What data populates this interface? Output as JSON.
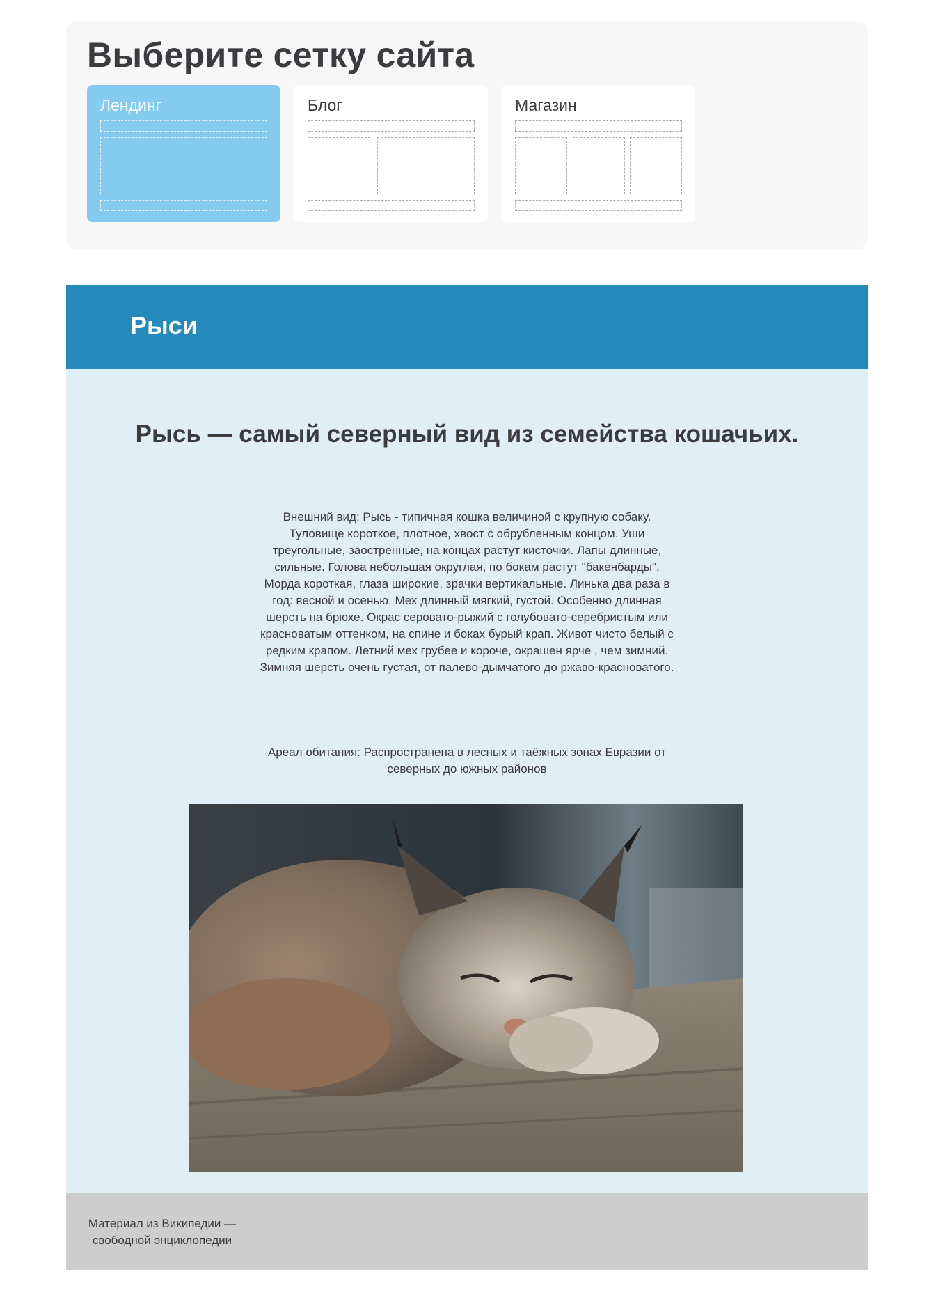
{
  "picker": {
    "title": "Выберите сетку сайта",
    "options": [
      {
        "label": "Лендинг",
        "selected": true
      },
      {
        "label": "Блог",
        "selected": false
      },
      {
        "label": "Магазин",
        "selected": false
      }
    ],
    "selected_color": "#83cbef"
  },
  "article": {
    "header_title": "Рыси",
    "headline": "Рысь — самый северный вид из семейства кошачьих.",
    "appearance": "Внешний вид: Рысь - типичная кошка величиной с крупную собаку. Туловище короткое, плотное, хвост с обрубленным концом. Уши треугольные, заостренные, на концах растут кисточки. Лапы длинные, сильные. Голова небольшая округлая, по бокам растут \"бакенбарды\". Морда короткая, глаза широкие, зрачки вертикальные. Линька два раза в год: весной и осенью. Мех длинный мягкий, густой. Особенно длинная шерсть на брюхе. Окрас серовато-рыжий с голубовато-серебристым или красноватым оттенком, на спине и боках бурый крап. Живот чисто белый с редким крапом. Летний мех грубее и короче, окрашен ярче , чем зимний. Зимняя шерсть очень густая, от палево-дымчатого до ржаво-красноватого.",
    "habitat": "Ареал обитания: Распространена в лесных и таёжных зонах Евразии от северных до южных районов",
    "photo": "lynx-photo"
  },
  "footer": {
    "source": "Материал из Википедии — свободной энциклопедии"
  },
  "colors": {
    "header_bg": "#2489bb",
    "content_bg": "#e0eff6",
    "footer_bg": "#cdcdcd",
    "panel_bg": "#f7f7f7",
    "text": "#3b3b40"
  }
}
